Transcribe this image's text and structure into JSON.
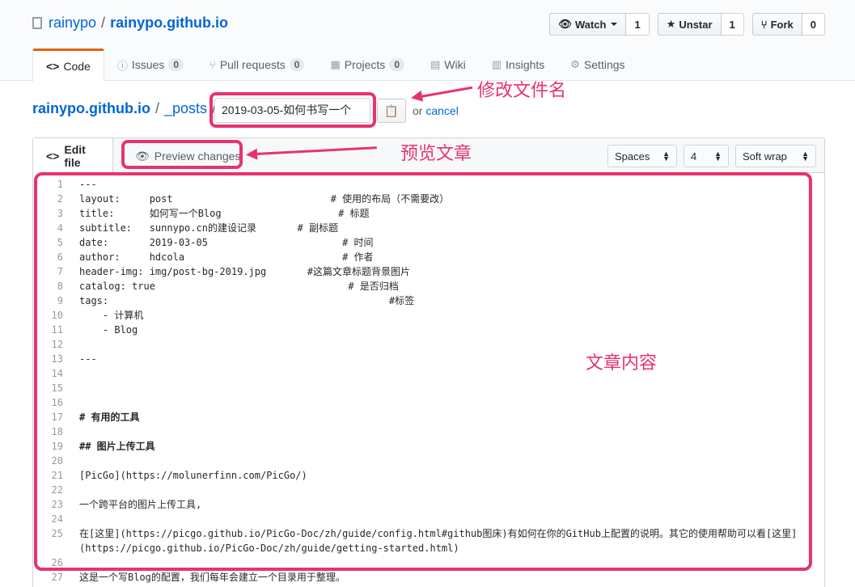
{
  "repo": {
    "owner": "rainypo",
    "separator": "/",
    "name": "rainypo.github.io",
    "watch": {
      "label": "Watch",
      "count": "1"
    },
    "unstar": {
      "label": "Unstar",
      "count": "1"
    },
    "fork": {
      "label": "Fork",
      "count": "0"
    }
  },
  "tabs": [
    {
      "label": "Code",
      "icon": "<>"
    },
    {
      "label": "Issues",
      "count": "0"
    },
    {
      "label": "Pull requests",
      "count": "0"
    },
    {
      "label": "Projects",
      "count": "0"
    },
    {
      "label": "Wiki"
    },
    {
      "label": "Insights"
    },
    {
      "label": "Settings"
    }
  ],
  "breadcrumb": {
    "root": "rainypo.github.io",
    "sep1": "/",
    "folder": "_posts",
    "sep2": "/",
    "filename": "2019-03-05-如何书写一个",
    "or_text": "or",
    "cancel": "cancel"
  },
  "annotations": {
    "rename": "修改文件名",
    "preview": "预览文章",
    "content": "文章内容"
  },
  "editor": {
    "edit_tab": "Edit file",
    "preview_tab": "Preview changes",
    "indent_mode": "Spaces",
    "indent_size": "4",
    "wrap_mode": "Soft wrap"
  },
  "code_lines": [
    {
      "n": "1",
      "t": "---"
    },
    {
      "n": "2",
      "t": "layout:     post                           # 使用的布局（不需要改）"
    },
    {
      "n": "3",
      "t": "title:      如何写一个Blog                    # 标题"
    },
    {
      "n": "4",
      "t": "subtitle:   sunnypo.cn的建设记录       # 副标题"
    },
    {
      "n": "5",
      "t": "date:       2019-03-05                       # 时间"
    },
    {
      "n": "6",
      "t": "author:     hdcola                           # 作者"
    },
    {
      "n": "7",
      "t": "header-img: img/post-bg-2019.jpg       #这篇文章标题背景图片"
    },
    {
      "n": "8",
      "t": "catalog: true                                 # 是否归档"
    },
    {
      "n": "9",
      "t": "tags:                                                #标签"
    },
    {
      "n": "10",
      "t": "    - 计算机"
    },
    {
      "n": "11",
      "t": "    - Blog"
    },
    {
      "n": "12",
      "t": ""
    },
    {
      "n": "13",
      "t": "---"
    },
    {
      "n": "14",
      "t": ""
    },
    {
      "n": "15",
      "t": ""
    },
    {
      "n": "16",
      "t": ""
    },
    {
      "n": "17",
      "t": "# 有用的工具"
    },
    {
      "n": "18",
      "t": ""
    },
    {
      "n": "19",
      "t": "## 图片上传工具"
    },
    {
      "n": "20",
      "t": ""
    },
    {
      "n": "21",
      "t": "[PicGo](https://molunerfinn.com/PicGo/)"
    },
    {
      "n": "22",
      "t": ""
    },
    {
      "n": "23",
      "t": "一个跨平台的图片上传工具,"
    },
    {
      "n": "24",
      "t": ""
    },
    {
      "n": "25",
      "t": "在[这里](https://picgo.github.io/PicGo-Doc/zh/guide/config.html#github图床)有如何在你的GitHub上配置的说明。其它的使用帮助可以看[这里](https://picgo.github.io/PicGo-Doc/zh/guide/getting-started.html)"
    },
    {
      "n": "26",
      "t": ""
    },
    {
      "n": "27",
      "t": "这是一个写Blog的配置，我们每年会建立一个目录用于整理。"
    }
  ]
}
